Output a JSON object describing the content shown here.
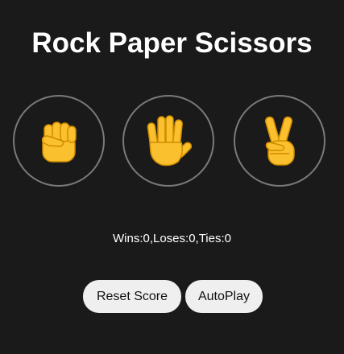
{
  "title": "Rock Paper Scissors",
  "moves": [
    {
      "name": "rock",
      "icon": "raised-fist-icon"
    },
    {
      "name": "paper",
      "icon": "raised-hand-icon"
    },
    {
      "name": "scissors",
      "icon": "victory-hand-icon"
    }
  ],
  "score": {
    "text": "Wins:0,Loses:0,Ties:0",
    "wins": 0,
    "loses": 0,
    "ties": 0
  },
  "buttons": {
    "reset_label": "Reset Score",
    "autoplay_label": "AutoPlay"
  },
  "colors": {
    "background": "#1a1a1a",
    "circle_border": "#7a7a7a",
    "emoji_yellow": "#fbc02d",
    "button_bg": "#efefef"
  }
}
